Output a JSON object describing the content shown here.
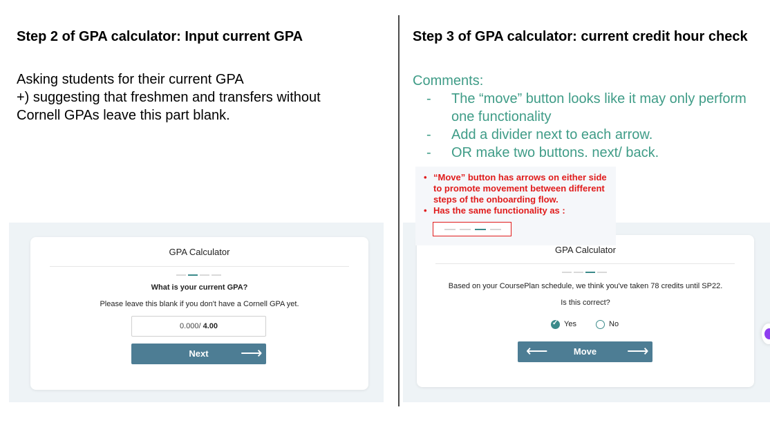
{
  "left": {
    "title": "Step 2 of GPA calculator: Input current GPA",
    "body_line1": "Asking students for their current GPA",
    "body_line2": "+) suggesting that freshmen and transfers without",
    "body_line3": "Cornell GPAs leave this part blank.",
    "card": {
      "title": "GPA Calculator",
      "question": "What is your current GPA?",
      "hint": "Please leave this blank if you don't have a Cornell GPA yet.",
      "input_value": "0.000/",
      "input_max": "4.00",
      "next_label": "Next",
      "next_arrow": "⟶",
      "progress_total": 4,
      "progress_active": 2
    }
  },
  "right": {
    "title": "Step 3 of GPA calculator: current credit hour check",
    "comments_heading": "Comments:",
    "comments": [
      {
        "dash": "-",
        "text": "The “move” button looks like it may only perform one functionality"
      },
      {
        "dash": "-",
        "text": "Add a divider next to each arrow."
      },
      {
        "dash": "-",
        "text": "OR make two buttons. next/ back."
      }
    ],
    "notes": [
      "“Move” button has arrows on either side to promote movement between different steps of the onboarding flow.",
      "Has the same functionality as :"
    ],
    "card": {
      "title": "GPA Calculator",
      "question": "Based on your CoursePlan schedule, we think you've taken 78 credits until SP22.",
      "prompt": "Is this correct?",
      "yes_label": "Yes",
      "no_label": "No",
      "selected": "Yes",
      "move_label": "Move",
      "back_arrow": "⟵",
      "forward_arrow": "⟶",
      "progress_total": 4,
      "progress_active": 3
    }
  },
  "colors": {
    "comment_green": "#3f9c87",
    "note_red": "#e01b1b",
    "button_blue": "#4d7d94",
    "accent_teal": "#3b8a8a"
  }
}
